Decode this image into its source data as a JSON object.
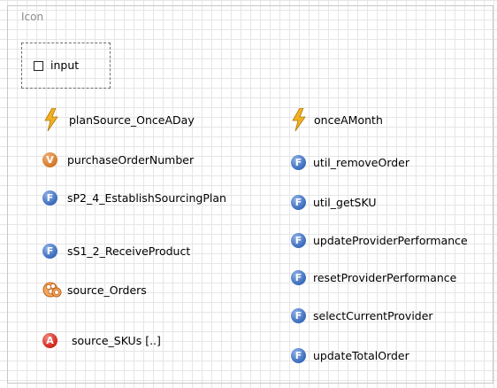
{
  "section_title": "Icon",
  "input": {
    "label": "input"
  },
  "left_items": [
    {
      "label": "planSource_OnceADay",
      "icon": "event-bolt-icon"
    },
    {
      "label": "purchaseOrderNumber",
      "icon": "variable-v-icon"
    },
    {
      "label": "sP2_4_EstablishSourcingPlan",
      "icon": "function-f-icon"
    },
    {
      "label": "sS1_2_ReceiveProduct",
      "icon": "function-f-icon"
    },
    {
      "label": "source_Orders",
      "icon": "collection-icon"
    },
    {
      "label": "source_SKUs [..]",
      "icon": "agent-population-a-icon"
    }
  ],
  "right_items": [
    {
      "label": "onceAMonth",
      "icon": "event-bolt-icon"
    },
    {
      "label": "util_removeOrder",
      "icon": "function-f-icon"
    },
    {
      "label": "util_getSKU",
      "icon": "function-f-icon"
    },
    {
      "label": "updateProviderPerformance",
      "icon": "function-f-icon"
    },
    {
      "label": "resetProviderPerformance",
      "icon": "function-f-icon"
    },
    {
      "label": "selectCurrentProvider",
      "icon": "function-f-icon"
    },
    {
      "label": "updateTotalOrder",
      "icon": "function-f-icon"
    }
  ],
  "icon_letters": {
    "function": "F",
    "variable": "V",
    "agent_population": "A"
  },
  "colors": {
    "function_icon": "#3f6fbf",
    "variable_icon": "#d47a2c",
    "agent_icon": "#d42a20",
    "event_icon": "#f0b020",
    "collection_icon": "#e07a2a"
  }
}
